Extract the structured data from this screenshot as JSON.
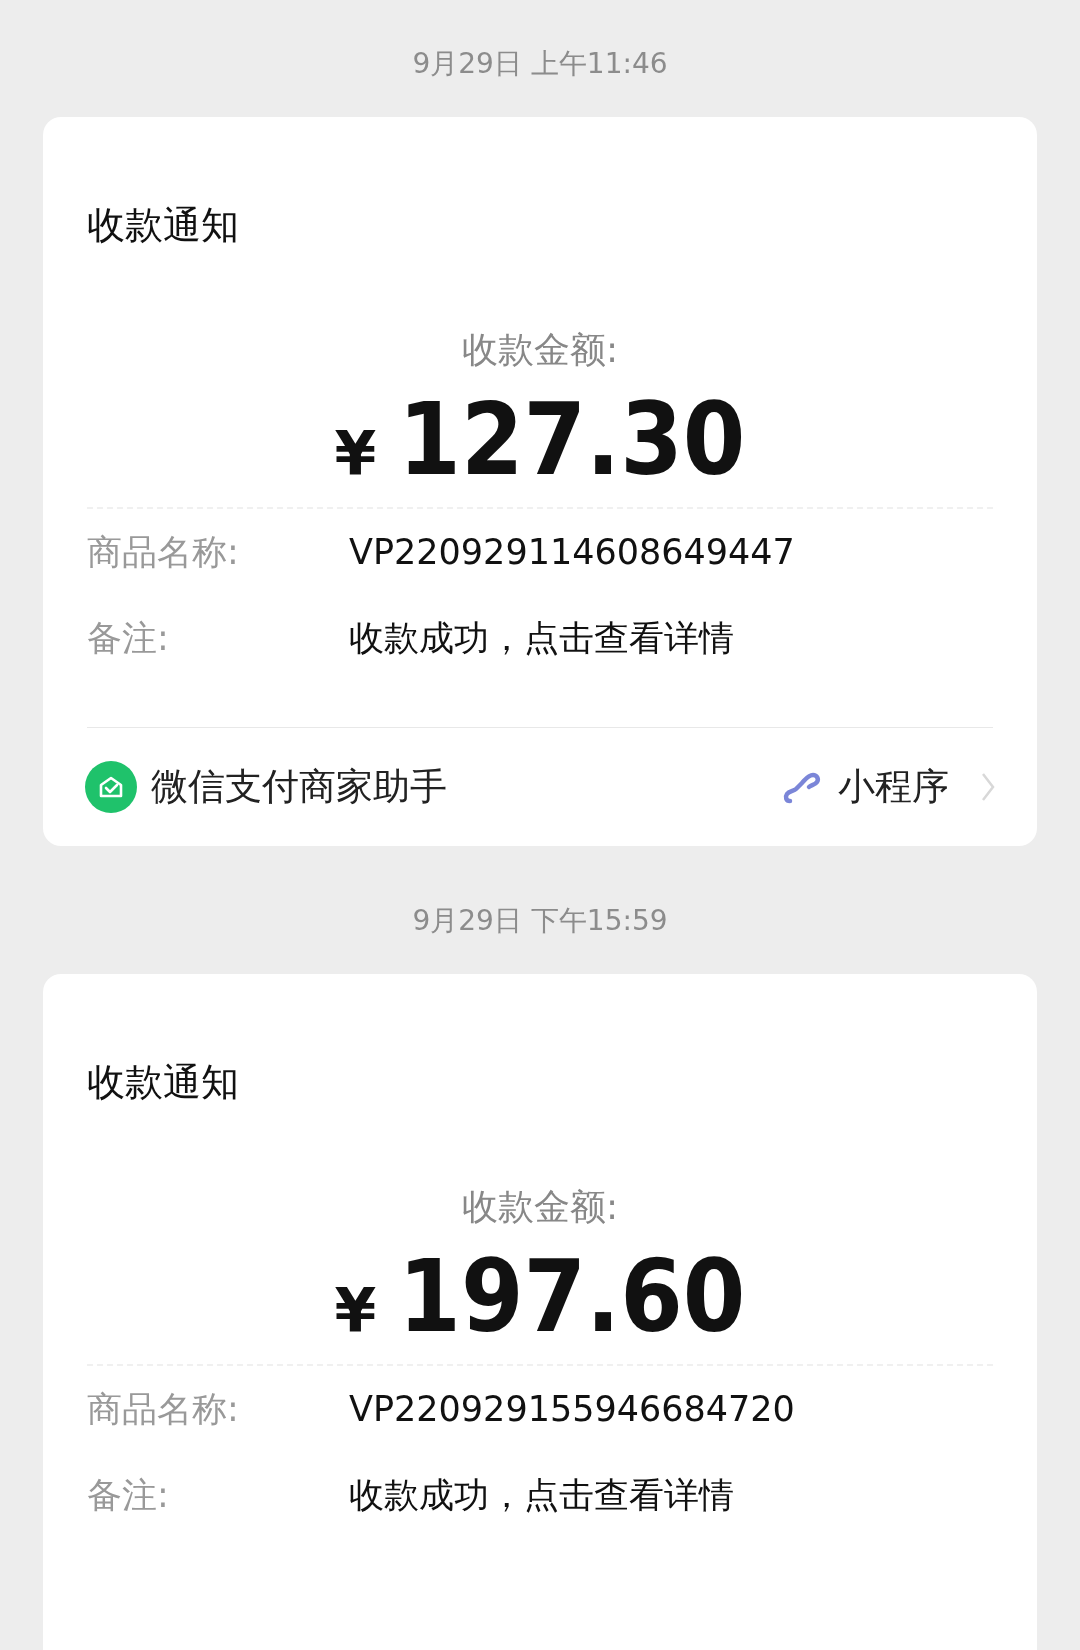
{
  "messages": [
    {
      "time": "9月29日 上午11:46",
      "card": {
        "title": "收款通知",
        "amount_label": "收款金额:",
        "currency": "¥",
        "amount": "127.30",
        "rows": [
          {
            "label": "商品名称:",
            "value": "VP220929114608649447"
          },
          {
            "label": "备注:",
            "value": "收款成功，点击查看详情"
          }
        ],
        "footer": {
          "app_name": "微信支付商家助手",
          "mini_program_label": "小程序"
        }
      }
    },
    {
      "time": "9月29日 下午15:59",
      "card": {
        "title": "收款通知",
        "amount_label": "收款金额:",
        "currency": "¥",
        "amount": "197.60",
        "rows": [
          {
            "label": "商品名称:",
            "value": "VP220929155946684720"
          },
          {
            "label": "备注:",
            "value": "收款成功，点击查看详情"
          }
        ]
      }
    }
  ]
}
